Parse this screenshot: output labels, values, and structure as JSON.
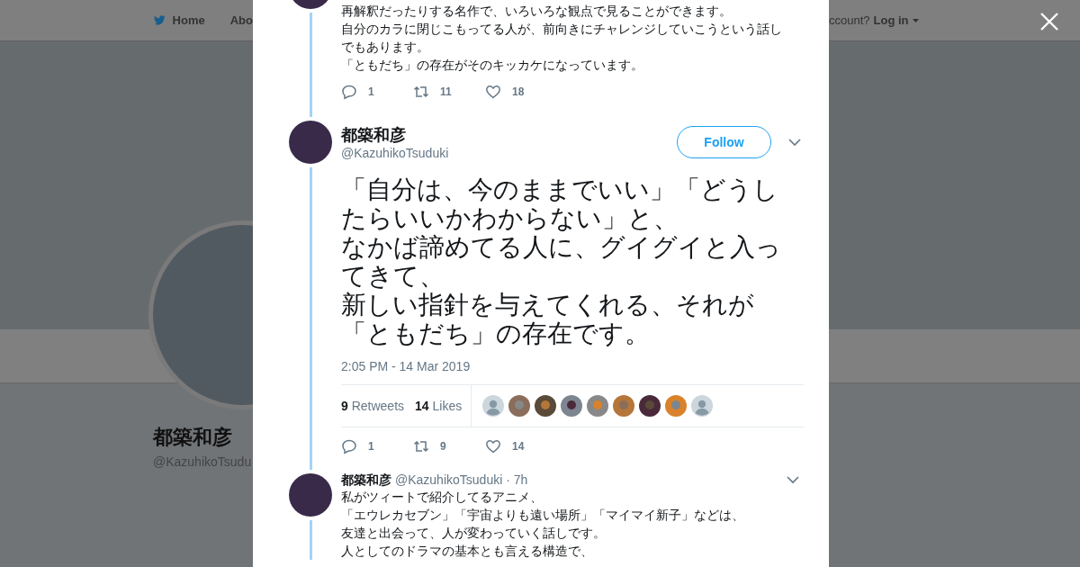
{
  "nav": {
    "items": [
      {
        "label": "Home"
      },
      {
        "label": "Abo"
      }
    ],
    "account_prompt": "ccount?",
    "login": "Log in"
  },
  "profile": {
    "name": "都築和彦",
    "handle": "@KazuhikoTsudu"
  },
  "previous_tweet": {
    "lines": [
      "再解釈だったりする名作で、いろいろな観点で見ることができます。",
      "自分のカラに閉じこもってる人が、前向きにチャレンジしていこうという話しでもあります。",
      "「ともだち」の存在がそのキッカケになっています。"
    ],
    "replies": "1",
    "retweets": "11",
    "likes": "18"
  },
  "focused_tweet": {
    "name": "都築和彦",
    "handle": "@KazuhikoTsuduki",
    "follow": "Follow",
    "lines": [
      "「自分は、今のままでいい」「どうしたらいいかわからない」と、",
      "なかば諦めてる人に、グイグイと入ってきて、",
      "新しい指針を与えてくれる、それが",
      "「ともだち」の存在です。"
    ],
    "date": "2:05 PM - 14 Mar 2019",
    "retweet_count": "9",
    "retweet_label": "Retweets",
    "like_count": "14",
    "like_label": "Likes",
    "liked_by": [
      {
        "kind": "default"
      },
      {
        "kind": "photo"
      },
      {
        "kind": "photo"
      },
      {
        "kind": "photo"
      },
      {
        "kind": "photo"
      },
      {
        "kind": "photo"
      },
      {
        "kind": "photo"
      },
      {
        "kind": "photo"
      },
      {
        "kind": "default"
      }
    ],
    "replies": "1",
    "retweets": "9",
    "likes": "14"
  },
  "next_tweet": {
    "name": "都築和彦",
    "handle": "@KazuhikoTsuduki",
    "time": "· 7h",
    "lines": [
      "私がツィートで紹介してるアニメ、",
      "「エウレカセブン」「宇宙よりも遠い場所」「マイマイ新子」などは、",
      "友達と出会って、人が変わっていく話しです。",
      "人としてのドラマの基本とも言える構造で、"
    ]
  }
}
